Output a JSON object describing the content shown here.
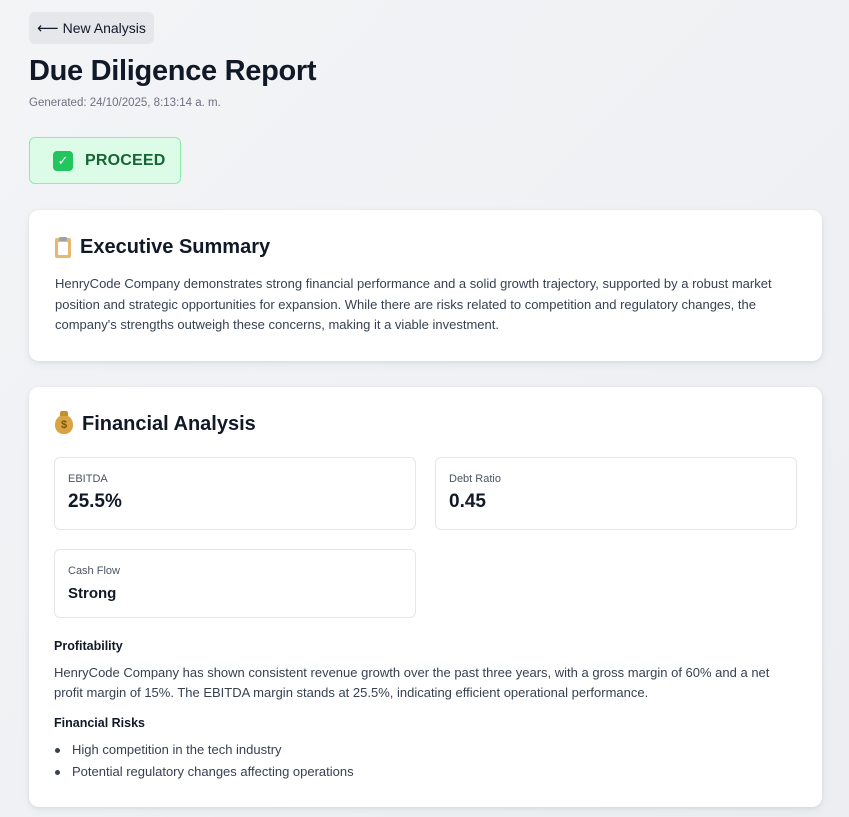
{
  "nav": {
    "back_arrow": "⟵",
    "back_label": "New Analysis"
  },
  "header": {
    "title": "Due Diligence Report",
    "generated": "Generated: 24/10/2025, 8:13:14 a. m."
  },
  "recommendation": {
    "icon": "check-box-icon",
    "check_glyph": "✓",
    "label": "PROCEED",
    "colors": {
      "background": "#dcfce7",
      "border": "#86efac",
      "text": "#166534",
      "icon": "#22c55e"
    }
  },
  "executive_summary": {
    "icon": "clipboard-icon",
    "title": "Executive Summary",
    "text": "HenryCode Company demonstrates strong financial performance and a solid growth trajectory, supported by a robust market position and strategic opportunities for expansion. While there are risks related to competition and regulatory changes, the company's strengths outweigh these concerns, making it a viable investment."
  },
  "financial_analysis": {
    "icon": "money-bag-icon",
    "money_glyph": "$",
    "title": "Financial Analysis",
    "metrics": [
      {
        "label": "EBITDA",
        "value": "25.5%"
      },
      {
        "label": "Debt Ratio",
        "value": "0.45"
      },
      {
        "label": "Cash Flow",
        "value": "Strong"
      }
    ],
    "profitability": {
      "heading": "Profitability",
      "text": "HenryCode Company has shown consistent revenue growth over the past three years, with a gross margin of 60% and a net profit margin of 15%. The EBITDA margin stands at 25.5%, indicating efficient operational performance."
    },
    "risks": {
      "heading": "Financial Risks",
      "items": [
        "High competition in the tech industry",
        "Potential regulatory changes affecting operations"
      ]
    }
  }
}
